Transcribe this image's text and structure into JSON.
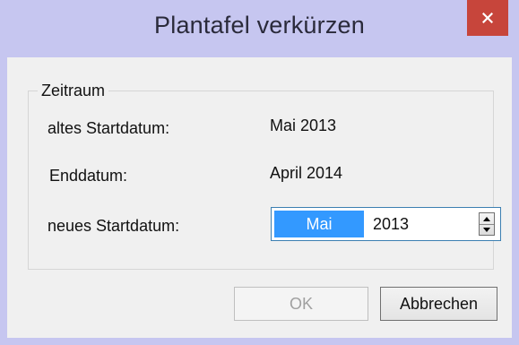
{
  "window": {
    "title": "Plantafel verkürzen",
    "close_glyph": "×"
  },
  "group": {
    "legend": "Zeitraum"
  },
  "fields": {
    "old_start_label": "altes Startdatum:",
    "old_start_value": "Mai 2013",
    "end_label": "Enddatum:",
    "end_value": "April 2014",
    "new_start_label": "neues Startdatum:"
  },
  "new_start_picker": {
    "month": "Mai",
    "year": "2013"
  },
  "buttons": {
    "ok_label": "OK",
    "ok_enabled": false,
    "cancel_label": "Abbrechen"
  },
  "colors": {
    "title_bar": "#c6c6f0",
    "close_button": "#c7453b",
    "selection": "#3399ff"
  },
  "icons": {
    "close": "close-icon",
    "spin_up": "arrow-up-icon",
    "spin_down": "arrow-down-icon"
  }
}
